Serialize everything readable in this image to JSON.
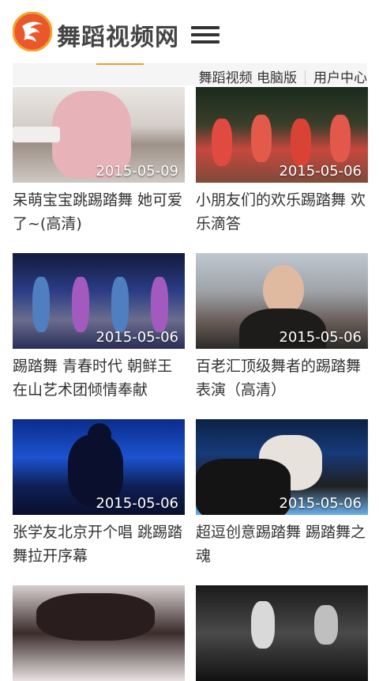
{
  "site": {
    "name": "舞蹈视频网"
  },
  "top_links": {
    "pc_version": "舞蹈视频 电脑版",
    "user_center": "用户中心"
  },
  "videos": [
    {
      "title": "呆萌宝宝跳踢踏舞 她可爱了~(高清)",
      "date": "2015-05-09"
    },
    {
      "title": "小朋友们的欢乐踢踏舞 欢乐滴答",
      "date": "2015-05-06"
    },
    {
      "title": "踢踏舞 青春时代 朝鲜王在山艺术团倾情奉献",
      "date": "2015-05-06"
    },
    {
      "title": "百老汇顶级舞者的踢踏舞表演（高清）",
      "date": "2015-05-06"
    },
    {
      "title": "张学友北京开个唱 跳踢踏舞拉开序幕",
      "date": "2015-05-06"
    },
    {
      "title": "超逗创意踢踏舞 踢踏舞之魂",
      "date": "2015-05-06"
    },
    {
      "title": "",
      "date": ""
    },
    {
      "title": "",
      "date": ""
    }
  ],
  "colors": {
    "accent": "#f39a2a",
    "logo": "#e5502a"
  }
}
